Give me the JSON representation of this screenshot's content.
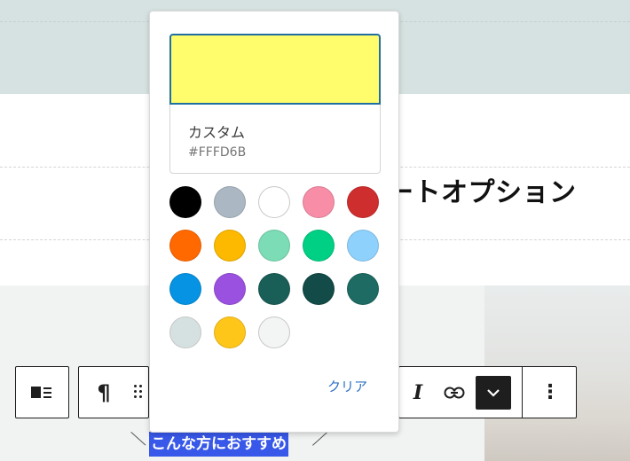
{
  "page": {
    "heading_partial": "ートオプション",
    "selected_text": "こんな方におすすめ"
  },
  "color_picker": {
    "current_color_name": "カスタム",
    "current_color_hex": "#FFFD6B",
    "current_color_hex_label": "#FFFD6B",
    "clear_label": "クリア",
    "palette": [
      "#000000",
      "#abb8c3",
      "#ffffff",
      "#f78da7",
      "#cf2e2e",
      "#ff6900",
      "#fcb900",
      "#7bdcb5",
      "#00d084",
      "#8ed1fc",
      "#0693e3",
      "#9b51e0",
      "#1a5e58",
      "#124b47",
      "#1d6b63",
      "#d5e1e0",
      "#ffc61a",
      "#f3f4f4"
    ]
  },
  "toolbar": {
    "align_icon": "align-left-with-text-icon",
    "paragraph_icon": "¶",
    "drag_icon": "drag-handle-icon",
    "italic_label": "I",
    "link_icon": "link-icon",
    "more_icon": "chevron-down-icon",
    "options_icon": "⋮"
  },
  "colors": {
    "accent": "#3858e9",
    "selection_border": "#1f6fa1",
    "link": "#2f72c4"
  }
}
